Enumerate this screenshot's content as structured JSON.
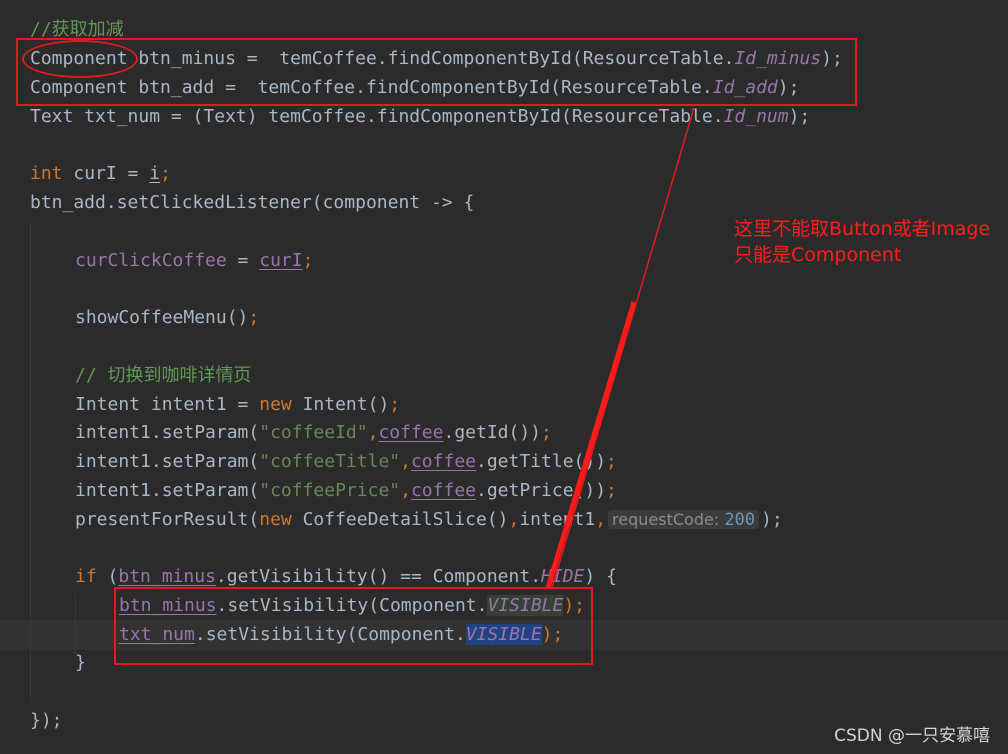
{
  "code": {
    "l1_comment": "//获取加减",
    "l2_type": "Component",
    "l2_rest": " btn_minus =  temCoffee.findComponentById(ResourceTable.",
    "l2_field": "Id_minus",
    "l2_end": ");",
    "l3_rest": "Component btn_add =  temCoffee.findComponentById(ResourceTable.",
    "l3_field": "Id_add",
    "l3_end": ");",
    "l4_rest": "Text txt_num = (Text) temCoffee.findComponentById(ResourceTable.",
    "l4_field": "Id_num",
    "l4_end": ");",
    "l5_kw": "int",
    "l5_mid": " curI = ",
    "l5_var": "i",
    "l5_end": ";",
    "l6": "btn_add.setClickedListener(component -> {",
    "l7_field": "curClickCoffee",
    "l7_mid": " = ",
    "l7_var": "curI",
    "l7_end": ";",
    "l8_call": "showCoffeeMenu()",
    "l8_end": ";",
    "l9_comment": "// 切换到咖啡详情页",
    "l10_a": "Intent intent1 = ",
    "l10_kw": "new",
    "l10_b": " Intent()",
    "l10_end": ";",
    "l11_a": "intent1.setParam(",
    "l11_str": "\"coffeeId\"",
    "l11_comma": ",",
    "l11_var": "coffee",
    "l11_b": ".getId())",
    "l11_end": ";",
    "l12_a": "intent1.setParam(",
    "l12_str": "\"coffeeTitle\"",
    "l12_comma": ",",
    "l12_var": "coffee",
    "l12_b": ".getTitle())",
    "l12_end": ";",
    "l13_a": "intent1.setParam(",
    "l13_str": "\"coffeePrice\"",
    "l13_comma": ",",
    "l13_var": "coffee",
    "l13_b": ".getPrice())",
    "l13_end": ";",
    "l14_a": "presentForResult(",
    "l14_kw": "new",
    "l14_b": " CoffeeDetailSlice()",
    "l14_comma": ",",
    "l14_c": "intent1",
    "l14_comma2": ",",
    "l14_hint_name": "requestCode:",
    "l14_hint_val": "200",
    "l14_end": ");",
    "l15_kw": "if",
    "l15_a": " (",
    "l15_var": "btn_minus",
    "l15_b": ".getVisibility() == Component.",
    "l15_field": "HIDE",
    "l15_end": ") {",
    "l16_var": "btn_minus",
    "l16_a": ".setVisibility(Component.",
    "l16_field": "VISIBLE",
    "l16_end": ");",
    "l17_var": "txt_num",
    "l17_a": ".setVisibility(Component.",
    "l17_field": "VISIBLE",
    "l17_end": ");",
    "l18": "}",
    "l19": "});"
  },
  "annotation": {
    "line1": "这里不能取Button或者Image",
    "line2": "只能是Component",
    "color": "#e01b1b"
  },
  "watermark": "CSDN @一只安慕嘻"
}
